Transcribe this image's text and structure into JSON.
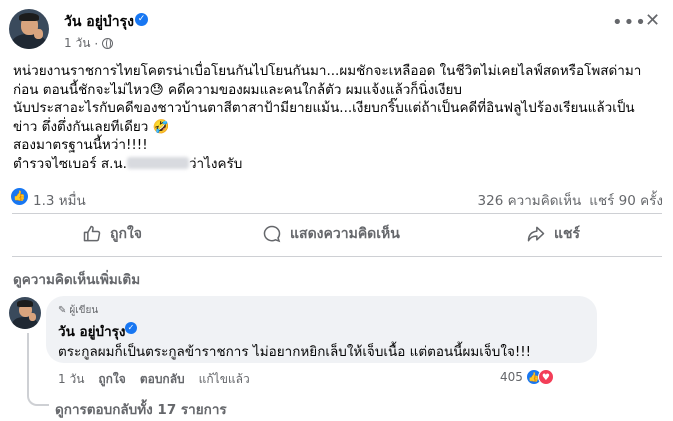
{
  "post": {
    "author": "วัน อยู่บำรุง",
    "time": "1 วัน",
    "more_icon": "more-horizontal-icon",
    "close_icon": "close-icon",
    "text_lines": [
      "หน่วยงานราชการไทยโคตรน่าเบื่อโยนกันไปโยนกันมา...ผมชักจะเหลืออด ในชีวิตไม่เคยไลฟ์สดหรือโพสด่ามา",
      "ก่อน ตอนนี้ชักจะไม่ไหว😓 คดีความของผมและคนใกล้ตัว ผมแจ้งแล้วก็นิ่งเงียบ",
      "นับประสาอะไรกับคดีของชาวบ้านตาสีตาสาป้ามียายแม้น...เงียบกริ๊บแต่ถ้าเป็นคดีที่อินฟลูไปร้องเรียนแล้วเป็น",
      "ข่าว ตึ่งตึ่งกันเลยทีเดียว 🤣",
      "สองมาตรฐานนี้หว่า!!!!"
    ],
    "last_line_prefix": "ตำรวจไซเบอร์ ส.น.",
    "last_line_suffix": "ว่าไงครับ",
    "reactions_count": "1.3 หมื่น",
    "comments_count": "326 ความคิดเห็น",
    "shares_count": "แชร์ 90 ครั้ง"
  },
  "actions": {
    "like": "ถูกใจ",
    "comment": "แสดงความคิดเห็น",
    "share": "แชร์"
  },
  "comments": {
    "more_label": "ดูความคิดเห็นเพิ่มเติม",
    "items": [
      {
        "badge": "ผู้เขียน",
        "author": "วัน อยู่บำรุง",
        "text": "ตระกูลผมก็เป็นตระกูลข้าราชการ ไม่อยากหยิกเล็บให้เจ็บเนื้อ แต่ตอนนี้ผมเจ็บใจ!!!",
        "time": "1 วัน",
        "like": "ถูกใจ",
        "reply": "ตอบกลับ",
        "edited": "แก้ไขแล้ว",
        "reaction_count": "405"
      }
    ],
    "view_replies": "ดูการตอบกลับทั้ง 17 รายการ"
  },
  "colors": {
    "accent": "#1877f2",
    "love": "#f33e58",
    "muted": "#65676b"
  }
}
